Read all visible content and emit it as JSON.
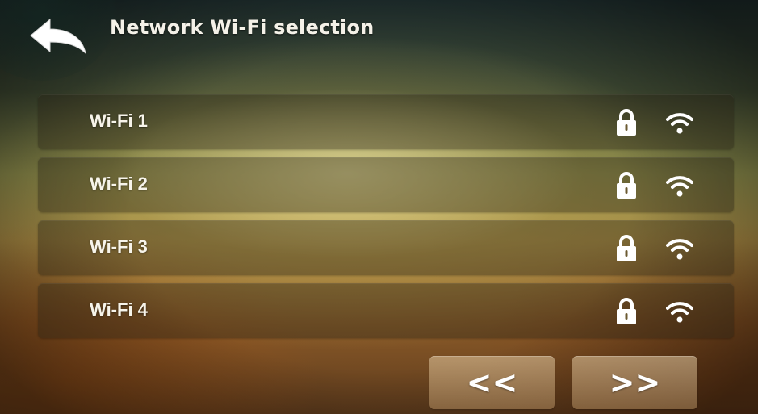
{
  "header": {
    "title": "Network Wi-Fi selection",
    "back_icon": "back-arrow-icon"
  },
  "networks": [
    {
      "name": "Wi-Fi 1",
      "locked": true,
      "lock_icon": "lock-icon",
      "signal_icon": "wifi-signal-icon"
    },
    {
      "name": "Wi-Fi 2",
      "locked": true,
      "lock_icon": "lock-icon",
      "signal_icon": "wifi-signal-icon"
    },
    {
      "name": "Wi-Fi 3",
      "locked": true,
      "lock_icon": "lock-icon",
      "signal_icon": "wifi-signal-icon"
    },
    {
      "name": "Wi-Fi 4",
      "locked": true,
      "lock_icon": "lock-icon",
      "signal_icon": "wifi-signal-icon"
    }
  ],
  "pagination": {
    "prev_label": "<<",
    "next_label": ">>"
  },
  "colors": {
    "text": "#f7f4ea",
    "icon": "#ffffff",
    "row_bg": "rgba(40,35,20,0.38)",
    "button_bg": "#d9b988"
  }
}
